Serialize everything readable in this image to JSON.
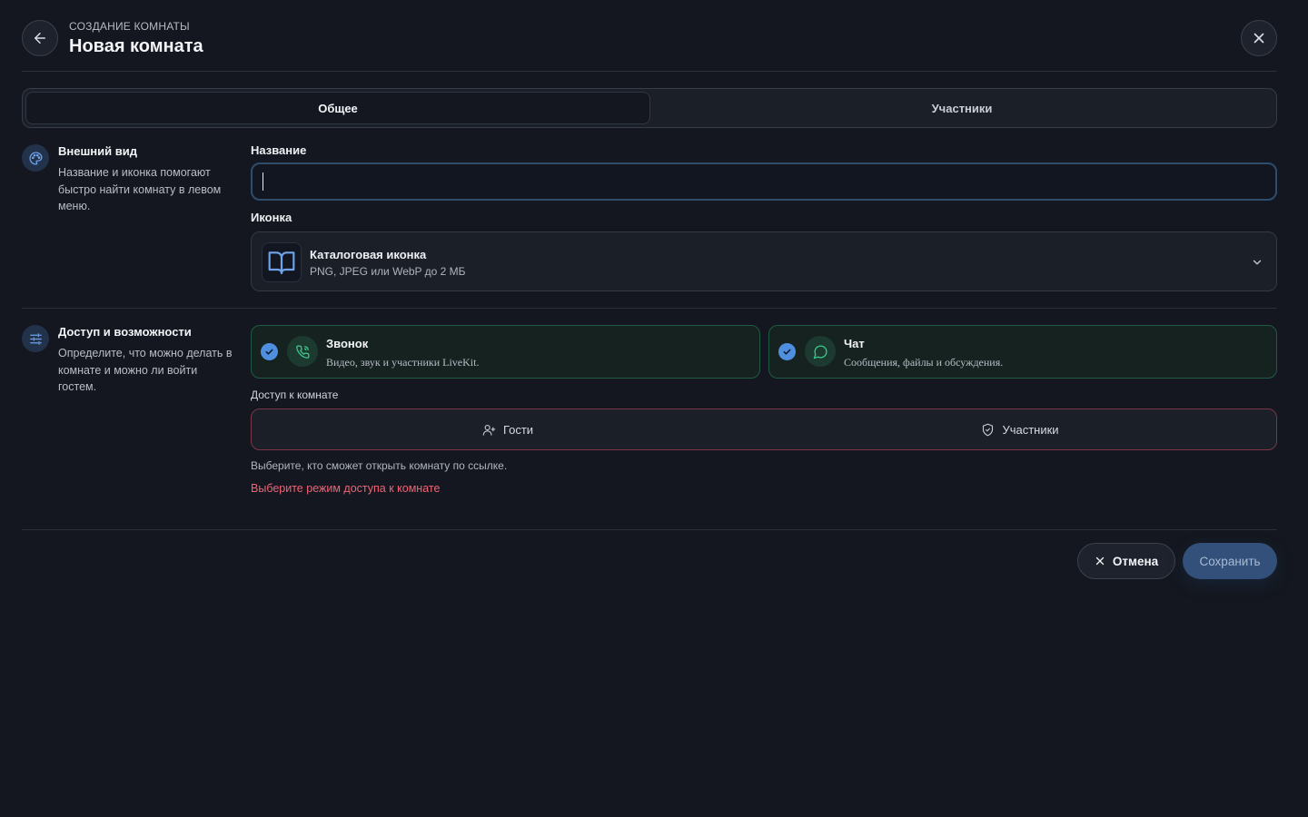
{
  "header": {
    "eyebrow": "СОЗДАНИЕ КОМНАТЫ",
    "title": "Новая комната",
    "back_icon": "arrow-left-icon",
    "close_icon": "close-icon"
  },
  "tabs": [
    {
      "label": "Общее",
      "active": true
    },
    {
      "label": "Участники",
      "active": false
    }
  ],
  "appearance": {
    "icon": "palette-icon",
    "title": "Внешний вид",
    "description": "Название и иконка помогают быстро найти комнату в левом меню.",
    "name_label": "Название",
    "name_value": "",
    "icon_label": "Иконка",
    "icon_select": {
      "preview_icon": "book-open-icon",
      "name": "Каталоговая иконка",
      "hint": "PNG, JPEG или WebP до 2 МБ"
    }
  },
  "access": {
    "icon": "sliders-icon",
    "title": "Доступ и возможности",
    "description": "Определите, что можно делать в комнате и можно ли войти гостем.",
    "features": [
      {
        "title": "Звонок",
        "description": "Видео, звук и участники LiveKit.",
        "checked": true,
        "icon": "phone-call-icon"
      },
      {
        "title": "Чат",
        "description": "Сообщения, файлы и обсуждения.",
        "checked": true,
        "icon": "chat-bubble-icon"
      }
    ],
    "room_access_label": "Доступ к комнате",
    "options": [
      {
        "label": "Гости",
        "icon": "user-plus-icon"
      },
      {
        "label": "Участники",
        "icon": "shield-check-icon"
      }
    ],
    "hint": "Выберите, кто сможет открыть комнату по ссылке.",
    "error": "Выберите режим доступа к комнате"
  },
  "footer": {
    "cancel_label": "Отмена",
    "save_label": "Сохранить"
  },
  "colors": {
    "background": "#14171f",
    "accent": "#4f8fe0",
    "success_border": "#1f5a45",
    "error": "#ee6476"
  }
}
